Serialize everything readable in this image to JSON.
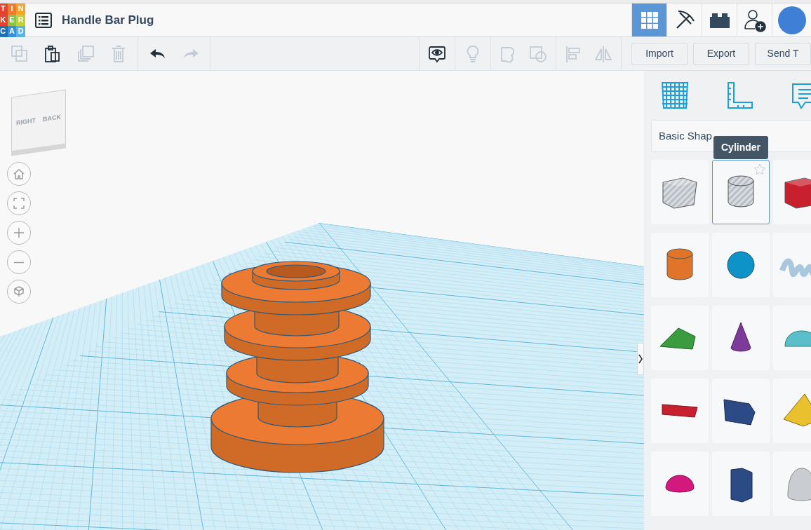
{
  "logo": {
    "letters": [
      {
        "char": "T",
        "color": "#e2442f"
      },
      {
        "char": "I",
        "color": "#f07c2a"
      },
      {
        "char": "N",
        "color": "#f5a425"
      },
      {
        "char": "K",
        "color": "#e2442f"
      },
      {
        "char": "E",
        "color": "#8bc34a"
      },
      {
        "char": "R",
        "color": "#c1d135"
      },
      {
        "char": "C",
        "color": "#1e6fb5"
      },
      {
        "char": "A",
        "color": "#3591d1"
      },
      {
        "char": "D",
        "color": "#5cb3e2"
      }
    ]
  },
  "project": {
    "title": "Handle Bar Plug"
  },
  "views": [
    {
      "kind": "grid",
      "selected": true
    },
    {
      "kind": "pickaxe",
      "selected": false
    },
    {
      "kind": "brick",
      "selected": false
    },
    {
      "kind": "add-user",
      "selected": false
    }
  ],
  "toolbar": {
    "groups": [
      [
        {
          "kind": "copy",
          "disabled": true
        },
        {
          "kind": "paste",
          "disabled": false
        },
        {
          "kind": "duplicate",
          "disabled": true
        },
        {
          "kind": "delete",
          "disabled": true
        }
      ],
      [
        {
          "kind": "undo",
          "disabled": false
        },
        {
          "kind": "redo",
          "disabled": true
        }
      ]
    ],
    "right_groups": [
      [
        {
          "kind": "notes",
          "disabled": false
        }
      ],
      [
        {
          "kind": "light",
          "disabled": true
        }
      ],
      [
        {
          "kind": "shape",
          "disabled": true
        },
        {
          "kind": "group",
          "disabled": true
        }
      ],
      [
        {
          "kind": "align",
          "disabled": true
        },
        {
          "kind": "mirror",
          "disabled": true
        }
      ]
    ],
    "buttons": [
      "Import",
      "Export",
      "Send T"
    ]
  },
  "view_cube": {
    "faces": [
      "RIGHT",
      "BACK"
    ]
  },
  "nav_controls": [
    {
      "kind": "home"
    },
    {
      "kind": "fit"
    },
    {
      "kind": "zoom-in"
    },
    {
      "kind": "zoom-out"
    },
    {
      "kind": "ortho"
    }
  ],
  "panel": {
    "tabs": [
      {
        "kind": "workplane"
      },
      {
        "kind": "ruler"
      },
      {
        "kind": "notes"
      }
    ],
    "category": "Basic Shap",
    "tooltip": "Cylinder",
    "shapes": [
      {
        "kind": "box",
        "color": "#b8bec6",
        "hole": true,
        "selected": false
      },
      {
        "kind": "cylinder",
        "color": "#b8bec6",
        "hole": true,
        "selected": true
      },
      {
        "kind": "box",
        "color": "#c8202f",
        "selected": false
      },
      {
        "kind": "cylinder",
        "color": "#e07428",
        "selected": false
      },
      {
        "kind": "sphere",
        "color": "#0e93c8",
        "selected": false
      },
      {
        "kind": "scribble",
        "color": "#a9c8de",
        "selected": false
      },
      {
        "kind": "roof",
        "color": "#3a9b3f",
        "selected": false
      },
      {
        "kind": "cone",
        "color": "#7e3a9a",
        "selected": false
      },
      {
        "kind": "round-roof",
        "color": "#5bbfc9",
        "selected": false
      },
      {
        "kind": "text",
        "color": "#c8202f",
        "selected": false
      },
      {
        "kind": "polygon",
        "color": "#2c4a86",
        "selected": false
      },
      {
        "kind": "pyramid",
        "color": "#e9c02e",
        "selected": false
      },
      {
        "kind": "half-sphere",
        "color": "#d4197e",
        "selected": false
      },
      {
        "kind": "hexagonal-prism",
        "color": "#2c4a86",
        "selected": false
      },
      {
        "kind": "paraboloid",
        "color": "#c9ccd0",
        "selected": false
      }
    ]
  }
}
